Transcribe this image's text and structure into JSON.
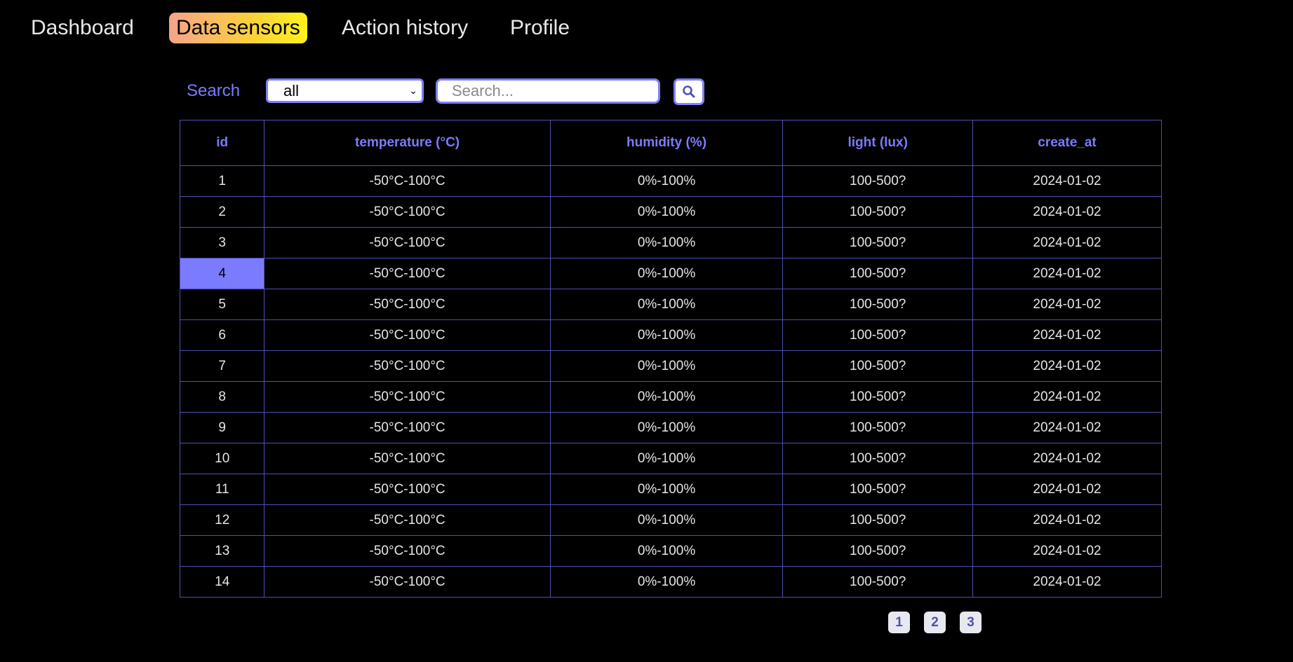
{
  "nav": {
    "items": [
      {
        "label": "Dashboard",
        "active": false
      },
      {
        "label": "Data sensors",
        "active": true
      },
      {
        "label": "Action history",
        "active": false
      },
      {
        "label": "Profile",
        "active": false
      }
    ]
  },
  "search": {
    "label": "Search",
    "filter_value": "all",
    "placeholder": "Search...",
    "button_icon": "search-icon"
  },
  "table": {
    "headers": [
      "id",
      "temperature (°C)",
      "humidity (%)",
      "light (lux)",
      "create_at"
    ],
    "selected_row_id": "4",
    "rows": [
      {
        "id": "1",
        "temperature": "-50°C-100°C",
        "humidity": "0%-100%",
        "light": "100-500?",
        "create_at": "2024-01-02"
      },
      {
        "id": "2",
        "temperature": "-50°C-100°C",
        "humidity": "0%-100%",
        "light": "100-500?",
        "create_at": "2024-01-02"
      },
      {
        "id": "3",
        "temperature": "-50°C-100°C",
        "humidity": "0%-100%",
        "light": "100-500?",
        "create_at": "2024-01-02"
      },
      {
        "id": "4",
        "temperature": "-50°C-100°C",
        "humidity": "0%-100%",
        "light": "100-500?",
        "create_at": "2024-01-02"
      },
      {
        "id": "5",
        "temperature": "-50°C-100°C",
        "humidity": "0%-100%",
        "light": "100-500?",
        "create_at": "2024-01-02"
      },
      {
        "id": "6",
        "temperature": "-50°C-100°C",
        "humidity": "0%-100%",
        "light": "100-500?",
        "create_at": "2024-01-02"
      },
      {
        "id": "7",
        "temperature": "-50°C-100°C",
        "humidity": "0%-100%",
        "light": "100-500?",
        "create_at": "2024-01-02"
      },
      {
        "id": "8",
        "temperature": "-50°C-100°C",
        "humidity": "0%-100%",
        "light": "100-500?",
        "create_at": "2024-01-02"
      },
      {
        "id": "9",
        "temperature": "-50°C-100°C",
        "humidity": "0%-100%",
        "light": "100-500?",
        "create_at": "2024-01-02"
      },
      {
        "id": "10",
        "temperature": "-50°C-100°C",
        "humidity": "0%-100%",
        "light": "100-500?",
        "create_at": "2024-01-02"
      },
      {
        "id": "11",
        "temperature": "-50°C-100°C",
        "humidity": "0%-100%",
        "light": "100-500?",
        "create_at": "2024-01-02"
      },
      {
        "id": "12",
        "temperature": "-50°C-100°C",
        "humidity": "0%-100%",
        "light": "100-500?",
        "create_at": "2024-01-02"
      },
      {
        "id": "13",
        "temperature": "-50°C-100°C",
        "humidity": "0%-100%",
        "light": "100-500?",
        "create_at": "2024-01-02"
      },
      {
        "id": "14",
        "temperature": "-50°C-100°C",
        "humidity": "0%-100%",
        "light": "100-500?",
        "create_at": "2024-01-02"
      }
    ]
  },
  "pagination": {
    "pages": [
      "1",
      "2",
      "3"
    ]
  },
  "colors": {
    "accent": "#7b7bff",
    "border": "#5050b0",
    "background": "#000000",
    "active_gradient_start": "#f7a38a",
    "active_gradient_end": "#fff21a"
  }
}
